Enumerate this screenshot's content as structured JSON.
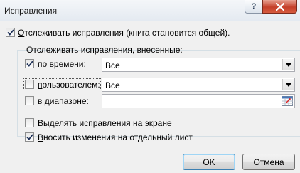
{
  "window": {
    "title": "Исправления",
    "help_label": "?"
  },
  "track_changes": {
    "checked": true,
    "label_underlined": "О",
    "label_rest": "тслеживать исправления (книга становится общей)."
  },
  "group": {
    "label": "Отслеживать исправления, внесенные:",
    "when": {
      "checked": true,
      "label_pre": "по вр",
      "label_underlined": "е",
      "label_post": "мени:",
      "value": "Все"
    },
    "who": {
      "checked": false,
      "label_underlined": "п",
      "label_rest": "ользователем:",
      "value": "Все"
    },
    "where": {
      "checked": false,
      "label_pre": "в ди",
      "label_underlined": "а",
      "label_post": "пазоне:",
      "value": ""
    }
  },
  "highlight_on_screen": {
    "checked": false,
    "label_pre": "В",
    "label_underlined": "ы",
    "label_post": "делять исправления на экране"
  },
  "list_on_new_sheet": {
    "checked": true,
    "label_underlined": "В",
    "label_rest": "носить изменения на отдельный лист"
  },
  "buttons": {
    "ok": "OK",
    "cancel": "Отмена"
  }
}
